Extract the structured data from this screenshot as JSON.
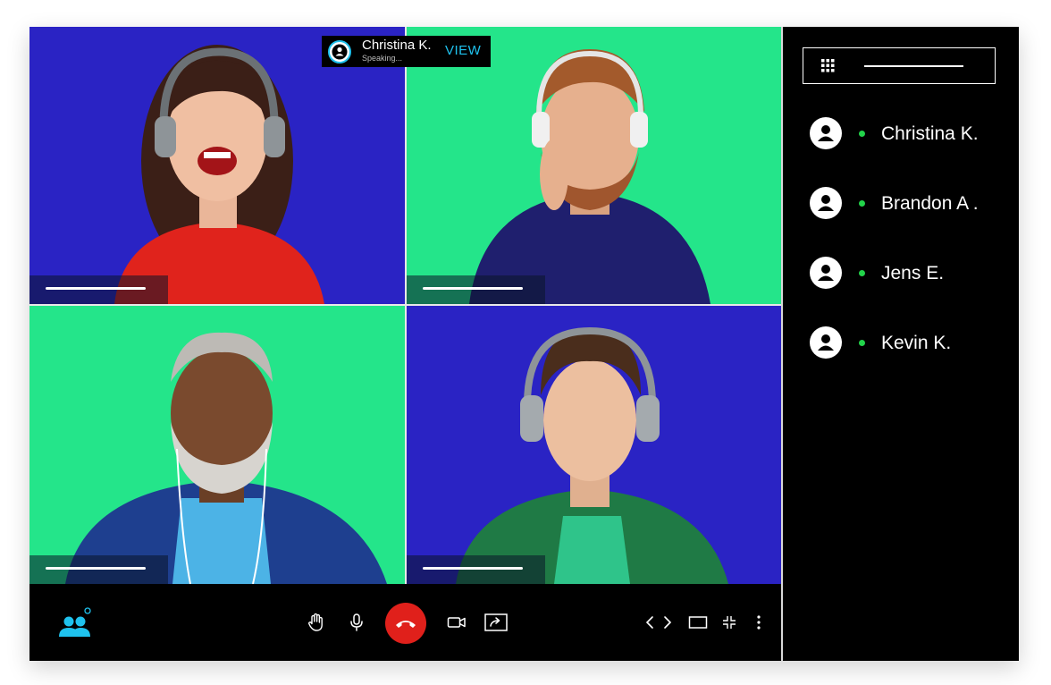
{
  "speaker": {
    "name": "Christina K.",
    "status": "Speaking...",
    "view_label": "VIEW"
  },
  "participants": [
    {
      "name": "Christina K.",
      "online": true
    },
    {
      "name": "Brandon A .",
      "online": true
    },
    {
      "name": "Jens E.",
      "online": true
    },
    {
      "name": "Kevin K.",
      "online": true
    }
  ],
  "toolbar": {
    "left": [
      "participants-icon"
    ],
    "center": [
      "raise-hand-icon",
      "microphone-icon",
      "end-call-icon",
      "camera-icon",
      "share-screen-icon"
    ],
    "right": [
      "prev-icon",
      "next-icon",
      "layout-icon",
      "minimize-icon",
      "more-icon"
    ]
  },
  "colors": {
    "blue_bg": "#2a23c4",
    "green_bg": "#24e58a",
    "accent": "#1fc2ee",
    "end_call": "#e0201b",
    "online": "#22d34a"
  }
}
